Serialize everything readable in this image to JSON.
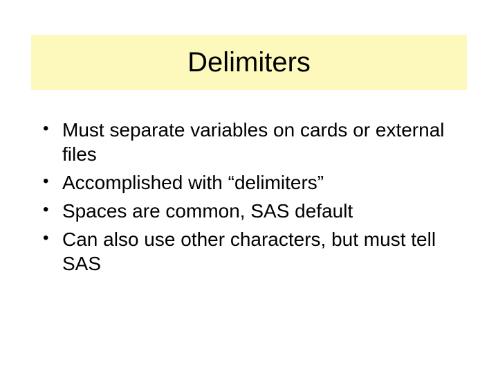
{
  "slide": {
    "title": "Delimiters",
    "bullets": [
      "Must separate variables on cards or external files",
      "Accomplished with “delimiters”",
      "Spaces are common, SAS default",
      "Can also use other characters, but must tell SAS"
    ]
  }
}
